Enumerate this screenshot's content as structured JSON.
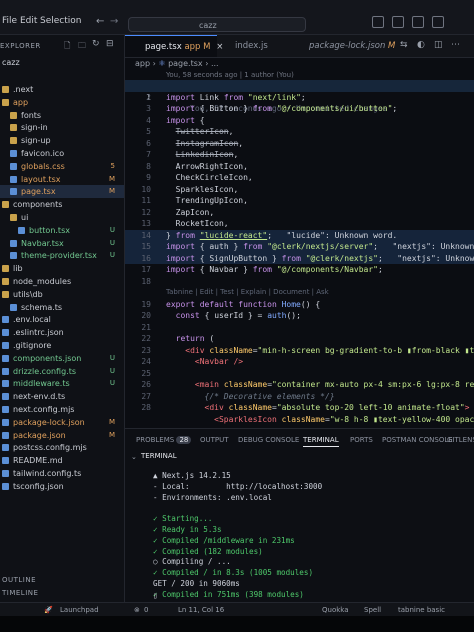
{
  "titlebar": {
    "menu": [
      "File",
      "Edit",
      "Selection"
    ],
    "search": "cazz"
  },
  "sidebar": {
    "header": "EXPLORER",
    "project": "cazz",
    "items": [
      {
        "label": ".next",
        "indent": 1,
        "type": "folder",
        "badge": ""
      },
      {
        "label": "app",
        "indent": 1,
        "type": "folder",
        "badge": "",
        "color": "#e0a15e"
      },
      {
        "label": "fonts",
        "indent": 2,
        "type": "folder",
        "badge": ""
      },
      {
        "label": "sign-in",
        "indent": 2,
        "type": "folder",
        "badge": ""
      },
      {
        "label": "sign-up",
        "indent": 2,
        "type": "folder",
        "badge": ""
      },
      {
        "label": "favicon.ico",
        "indent": 2,
        "type": "file",
        "badge": ""
      },
      {
        "label": "globals.css",
        "indent": 2,
        "type": "file",
        "badge": "5",
        "color": "#e0a15e"
      },
      {
        "label": "layout.tsx",
        "indent": 2,
        "type": "file",
        "badge": "M",
        "color": "#e0a15e"
      },
      {
        "label": "page.tsx",
        "indent": 2,
        "type": "file",
        "badge": "M",
        "color": "#e0a15e",
        "selected": true
      },
      {
        "label": "components",
        "indent": 1,
        "type": "folder",
        "badge": ""
      },
      {
        "label": "ui",
        "indent": 2,
        "type": "folder",
        "badge": ""
      },
      {
        "label": "button.tsx",
        "indent": 3,
        "type": "file",
        "badge": "U"
      },
      {
        "label": "Navbar.tsx",
        "indent": 2,
        "type": "file",
        "badge": "U"
      },
      {
        "label": "theme-provider.tsx",
        "indent": 2,
        "type": "file",
        "badge": "U"
      },
      {
        "label": "lib",
        "indent": 1,
        "type": "folder",
        "badge": ""
      },
      {
        "label": "node_modules",
        "indent": 1,
        "type": "folder",
        "badge": ""
      },
      {
        "label": "utils\\db",
        "indent": 1,
        "type": "folder",
        "badge": ""
      },
      {
        "label": "schema.ts",
        "indent": 2,
        "type": "file",
        "badge": ""
      },
      {
        "label": ".env.local",
        "indent": 1,
        "type": "file",
        "badge": ""
      },
      {
        "label": ".eslintrc.json",
        "indent": 1,
        "type": "file",
        "badge": ""
      },
      {
        "label": ".gitignore",
        "indent": 1,
        "type": "file",
        "badge": ""
      },
      {
        "label": "components.json",
        "indent": 1,
        "type": "file",
        "badge": "U"
      },
      {
        "label": "drizzle.config.ts",
        "indent": 1,
        "type": "file",
        "badge": "U"
      },
      {
        "label": "middleware.ts",
        "indent": 1,
        "type": "file",
        "badge": "U"
      },
      {
        "label": "next-env.d.ts",
        "indent": 1,
        "type": "file",
        "badge": ""
      },
      {
        "label": "next.config.mjs",
        "indent": 1,
        "type": "file",
        "badge": ""
      },
      {
        "label": "package-lock.json",
        "indent": 1,
        "type": "file",
        "badge": "M"
      },
      {
        "label": "package.json",
        "indent": 1,
        "type": "file",
        "badge": "M"
      },
      {
        "label": "postcss.config.mjs",
        "indent": 1,
        "type": "file",
        "badge": ""
      },
      {
        "label": "README.md",
        "indent": 1,
        "type": "file",
        "badge": ""
      },
      {
        "label": "tailwind.config.ts",
        "indent": 1,
        "type": "file",
        "badge": ""
      },
      {
        "label": "tsconfig.json",
        "indent": 1,
        "type": "file",
        "badge": ""
      }
    ],
    "outline": "OUTLINE",
    "timeline": "TIMELINE"
  },
  "tabs": [
    {
      "label": "page.tsx",
      "suffix": "app M",
      "active": true
    },
    {
      "label": "index.js",
      "suffix": "",
      "active": false
    },
    {
      "label": "package-lock.json",
      "suffix": "M",
      "active": false
    }
  ],
  "breadcrumb": [
    "app",
    "page.tsx",
    "..."
  ],
  "blame": "You, 58 seconds ago | 1 author (You)",
  "editor": {
    "line_numbers": [
      "1",
      "2",
      "3",
      "4",
      "5",
      "6",
      "7",
      "8",
      "9",
      "10",
      "11",
      "12",
      "13",
      "14",
      "15",
      "16",
      "17",
      "18",
      "19",
      "20",
      "21",
      "22",
      "23",
      "24",
      "25",
      "26",
      "27",
      "28"
    ],
    "ghost_line1": "You, 52 seconds ago • Uncommitted changes",
    "hints": {
      "codelens": "Tabnine | Edit | Test | Explain | Document | Ask",
      "lucide_error": "\"lucide\": Unknown word.",
      "nextjs_error1": "\"nextjs\": Unknown",
      "nextjs_error2": "\"nextjs\": Unknown"
    }
  },
  "panel": {
    "tabs": [
      {
        "label": "PROBLEMS",
        "count": "28"
      },
      {
        "label": "OUTPUT"
      },
      {
        "label": "DEBUG CONSOLE"
      },
      {
        "label": "TERMINAL",
        "active": true
      },
      {
        "label": "PORTS"
      },
      {
        "label": "POSTMAN CONSOLE"
      },
      {
        "label": "GITLENS"
      }
    ],
    "section": "TERMINAL",
    "lines": [
      "▲ Next.js 14.2.15",
      "- Local:        http://localhost:3000",
      "- Environments: .env.local",
      "",
      "✓ Starting...",
      "✓ Ready in 5.3s",
      "✓ Compiled /middleware in 231ms",
      "✓ Compiled (182 modules)",
      "○ Compiling / ...",
      "✓ Compiled / in 8.3s (1005 modules)",
      "GET / 200 in 9060ms",
      "✓ Compiled in 751ms (398 modules)"
    ],
    "prompt": "▯"
  },
  "statusbar": {
    "left": "Launchpad",
    "errors": "0",
    "position": "Ln 11, Col 16",
    "right": [
      "Quokka",
      "Spell",
      "tabnine basic"
    ]
  }
}
